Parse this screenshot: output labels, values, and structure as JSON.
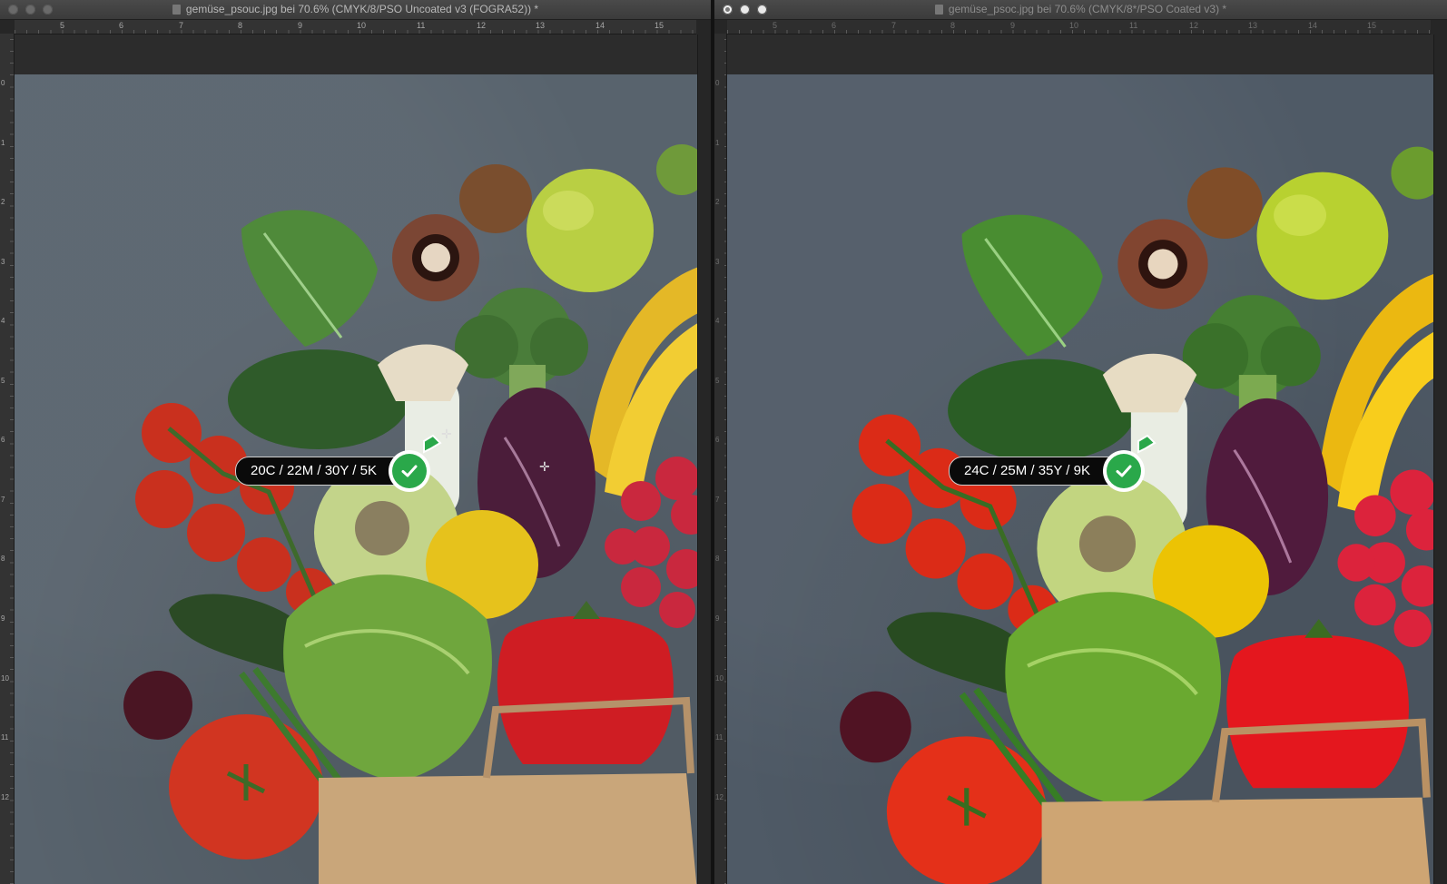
{
  "windows": [
    {
      "title": "gemüse_psouc.jpg bei 70.6% (CMYK/8/PSO Uncoated v3 (FOGRA52)) *",
      "ruler_ticks": [
        "5",
        "6",
        "7",
        "8",
        "9",
        "10",
        "11",
        "12",
        "13",
        "14",
        "15"
      ],
      "vruler_ticks": [
        "0",
        "1",
        "2",
        "3",
        "4",
        "5",
        "6",
        "7",
        "8",
        "9",
        "10",
        "11",
        "12"
      ],
      "readout": "20C / 22M / 30Y / 5K"
    },
    {
      "title": "gemüse_psoc.jpg bei 70.6% (CMYK/8*/PSO Coated v3) *",
      "ruler_ticks": [
        "5",
        "6",
        "7",
        "8",
        "9",
        "10",
        "11",
        "12",
        "13",
        "14",
        "15"
      ],
      "vruler_ticks": [
        "0",
        "1",
        "2",
        "3",
        "4",
        "5",
        "6",
        "7",
        "8",
        "9",
        "10",
        "11",
        "12"
      ],
      "readout": "24C / 25M / 35Y / 9K"
    }
  ],
  "colors": {
    "accent_check": "#2aa84a",
    "canvas_bg": "#58636d",
    "chrome": "#262626"
  },
  "icons": {
    "status": "check-circle-icon",
    "document": "document-icon",
    "cursor": "crosshair-icon"
  }
}
